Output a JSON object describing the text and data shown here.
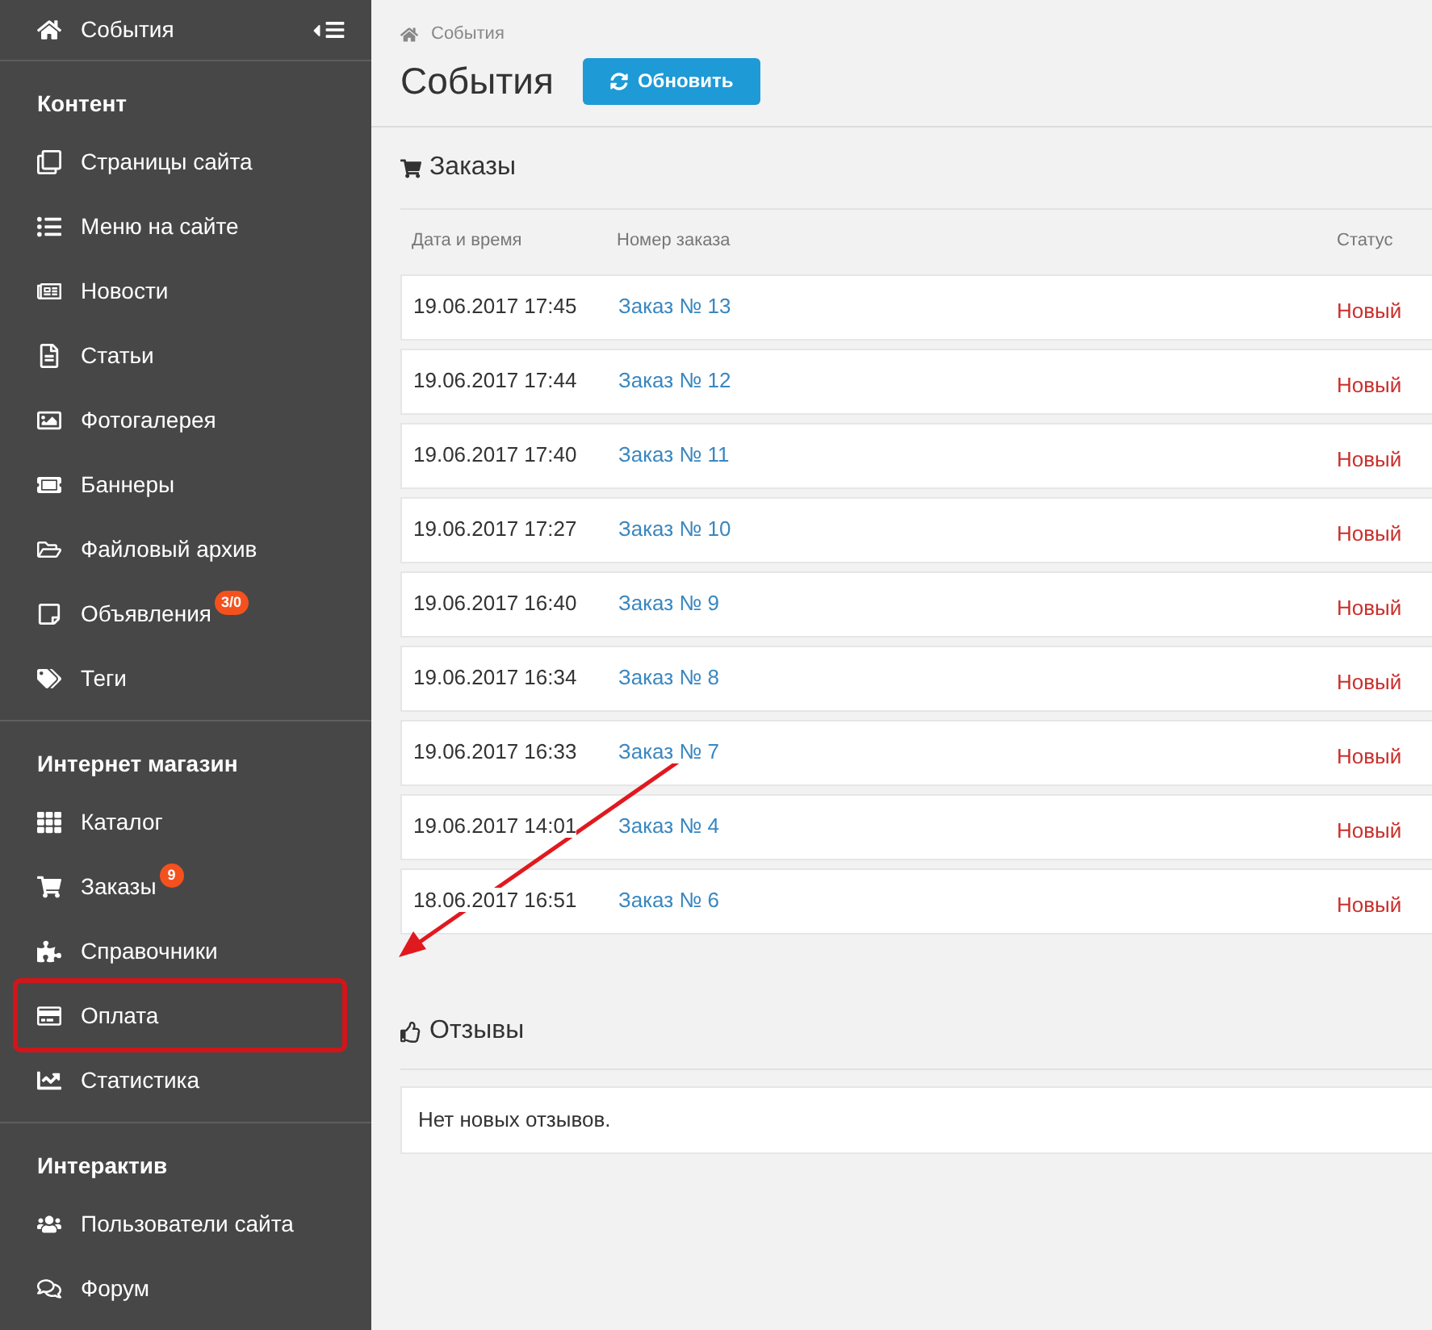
{
  "sidebar": {
    "top_item": {
      "label": "События"
    },
    "sections": [
      {
        "title": "Контент",
        "items": [
          {
            "label": "Страницы сайта",
            "highlighted": false
          },
          {
            "label": "Меню на сайте",
            "highlighted": false
          },
          {
            "label": "Новости",
            "highlighted": false
          },
          {
            "label": "Статьи",
            "highlighted": false
          },
          {
            "label": "Фотогалерея",
            "highlighted": false
          },
          {
            "label": "Баннеры",
            "highlighted": false
          },
          {
            "label": "Файловый архив",
            "highlighted": false
          },
          {
            "label": "Объявления",
            "badge": "3/0",
            "highlighted": false
          },
          {
            "label": "Теги",
            "highlighted": false
          }
        ]
      },
      {
        "title": "Интернет магазин",
        "items": [
          {
            "label": "Каталог",
            "highlighted": false
          },
          {
            "label": "Заказы",
            "badge": "9",
            "highlighted": false
          },
          {
            "label": "Справочники",
            "highlighted": false
          },
          {
            "label": "Оплата",
            "highlighted": true
          },
          {
            "label": "Статистика",
            "highlighted": false
          }
        ]
      },
      {
        "title": "Интерактив",
        "items": [
          {
            "label": "Пользователи сайта",
            "highlighted": false
          },
          {
            "label": "Форум",
            "highlighted": false
          }
        ]
      }
    ]
  },
  "breadcrumb": "События",
  "page_title": "События",
  "refresh_button": "Обновить",
  "orders": {
    "title": "Заказы",
    "columns": [
      "Дата и время",
      "Номер заказа",
      "Статус"
    ],
    "rows": [
      {
        "date": "19.06.2017 17:45",
        "order": "Заказ № 13",
        "status": "Новый"
      },
      {
        "date": "19.06.2017 17:44",
        "order": "Заказ № 12",
        "status": "Новый"
      },
      {
        "date": "19.06.2017 17:40",
        "order": "Заказ № 11",
        "status": "Новый"
      },
      {
        "date": "19.06.2017 17:27",
        "order": "Заказ № 10",
        "status": "Новый"
      },
      {
        "date": "19.06.2017 16:40",
        "order": "Заказ № 9",
        "status": "Новый"
      },
      {
        "date": "19.06.2017 16:34",
        "order": "Заказ № 8",
        "status": "Новый"
      },
      {
        "date": "19.06.2017 16:33",
        "order": "Заказ № 7",
        "status": "Новый"
      },
      {
        "date": "19.06.2017 14:01",
        "order": "Заказ № 4",
        "status": "Новый"
      },
      {
        "date": "18.06.2017 16:51",
        "order": "Заказ № 6",
        "status": "Новый"
      }
    ]
  },
  "reviews": {
    "title": "Отзывы",
    "empty_text": "Нет новых отзывов."
  },
  "annotation_arrow": true
}
